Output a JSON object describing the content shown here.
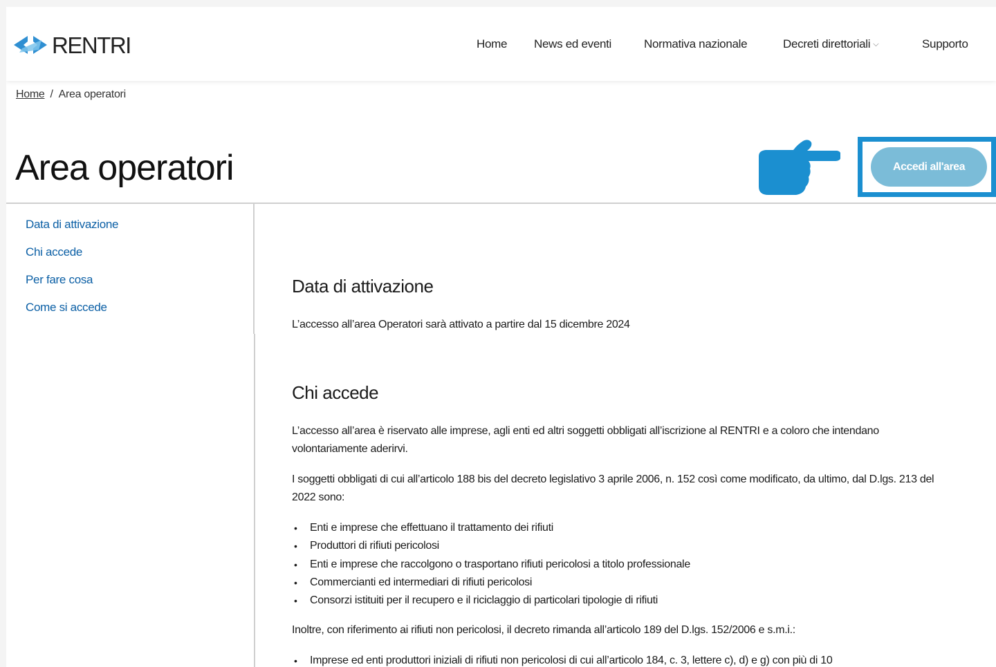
{
  "header": {
    "logo_text": "RENTRI",
    "nav": [
      {
        "label": "Home"
      },
      {
        "label": "News ed eventi"
      },
      {
        "label": "Normativa nazionale"
      },
      {
        "label": "Decreti direttoriali",
        "dropdown": true
      },
      {
        "label": "Supporto"
      }
    ]
  },
  "breadcrumb": {
    "home": "Home",
    "separator": "/",
    "current": "Area operatori"
  },
  "page_title": "Area operatori",
  "access_button": "Accedi all'area",
  "sidebar": {
    "items": [
      {
        "label": "Data di attivazione"
      },
      {
        "label": "Chi accede"
      },
      {
        "label": "Per fare cosa"
      },
      {
        "label": "Come si accede"
      }
    ]
  },
  "content": {
    "section1": {
      "heading": "Data di attivazione",
      "text": "L’accesso all’area Operatori sarà attivato a partire dal 15 dicembre 2024"
    },
    "section2": {
      "heading": "Chi accede",
      "p1": "L’accesso all’area è riservato alle imprese, agli enti ed altri soggetti obbligati all’iscrizione al RENTRI e a coloro che intendano volontariamente aderirvi.",
      "p2": "I soggetti obbligati di cui all’articolo 188 bis del decreto legislativo 3 aprile 2006, n. 152  così come modificato, da ultimo, dal D.lgs. 213 del 2022 sono:",
      "list": [
        "Enti e imprese che effettuano il trattamento dei rifiuti",
        "Produttori di rifiuti pericolosi",
        "Enti e imprese che raccolgono o trasportano rifiuti pericolosi a titolo professionale",
        "Commercianti ed intermediari di rifiuti pericolosi",
        "Consorzi istituiti per il recupero e il riciclaggio di particolari tipologie di rifiuti"
      ],
      "p3": "Inoltre, con riferimento ai rifiuti non pericolosi, il decreto rimanda all’articolo 189 del D.lgs. 152/2006 e s.m.i.:",
      "list2": [
        "Imprese ed enti produttori iniziali di rifiuti non pericolosi di cui all’articolo 184, c. 3, lettere c), d) e g) con più di 10"
      ]
    }
  },
  "colors": {
    "accent_blue": "#1b8fd0",
    "button_bg": "#7bbcd8",
    "link_blue": "#0b5fa5",
    "logo_blue": "#2f8fd2"
  },
  "icons": {
    "logo": "rentri-arrows-logo",
    "pointer": "pointing-hand-icon",
    "dropdown": "chevron-down-icon"
  }
}
